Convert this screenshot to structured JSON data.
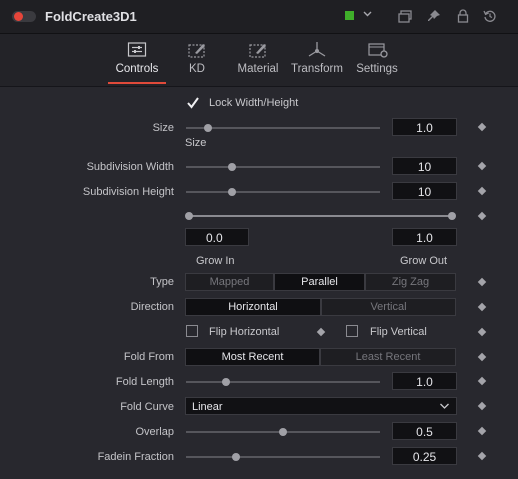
{
  "header": {
    "title": "FoldCreate3D1",
    "color_swatch": "#3fae2a",
    "icons": [
      "power-toggle",
      "color-chevron",
      "versions-icon",
      "pin-icon",
      "lock-icon",
      "reset-icon"
    ]
  },
  "tabs": [
    {
      "label": "Controls",
      "icon": "controls-icon",
      "active": true
    },
    {
      "label": "KD",
      "icon": "kd-icon",
      "active": false
    },
    {
      "label": "Material",
      "icon": "material-icon",
      "active": false
    },
    {
      "label": "Transform",
      "icon": "transform-icon",
      "active": false
    },
    {
      "label": "Settings",
      "icon": "settings-icon",
      "active": false
    }
  ],
  "controls": {
    "lock": {
      "label": "Lock Width/Height",
      "checked": true
    },
    "size": {
      "label": "Size",
      "sublabel": "Size",
      "value": "1.0",
      "slider": 0.1
    },
    "subdiv_width": {
      "label": "Subdivision Width",
      "value": "10",
      "slider": 0.22
    },
    "subdiv_height": {
      "label": "Subdivision Height",
      "value": "10",
      "slider": 0.22
    },
    "grow": {
      "in_value": "0.0",
      "out_value": "1.0",
      "in_label": "Grow In",
      "out_label": "Grow Out"
    },
    "type": {
      "label": "Type",
      "options": [
        "Mapped",
        "Parallel",
        "Zig Zag"
      ],
      "selected": 1
    },
    "direction": {
      "label": "Direction",
      "options": [
        "Horizontal",
        "Vertical"
      ],
      "selected": 0
    },
    "flip_h": {
      "label": "Flip Horizontal",
      "checked": false
    },
    "flip_v": {
      "label": "Flip Vertical",
      "checked": false
    },
    "fold_from": {
      "label": "Fold From",
      "options": [
        "Most Recent",
        "Least Recent"
      ],
      "selected": 0
    },
    "fold_length": {
      "label": "Fold Length",
      "value": "1.0",
      "slider": 0.2
    },
    "fold_curve": {
      "label": "Fold Curve",
      "value": "Linear"
    },
    "overlap": {
      "label": "Overlap",
      "value": "0.5",
      "slider": 0.5
    },
    "fadein": {
      "label": "Fadein Fraction",
      "value": "0.25",
      "slider": 0.25
    }
  }
}
